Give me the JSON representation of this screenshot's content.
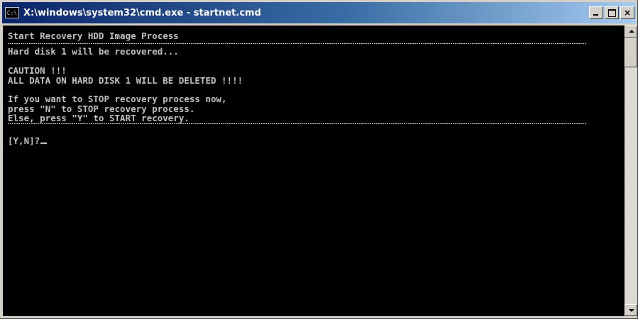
{
  "window": {
    "title": "X:\\windows\\system32\\cmd.exe - startnet.cmd",
    "icon_label": "C:\\",
    "buttons": {
      "minimize": "minimize",
      "maximize": "maximize",
      "close": "×"
    }
  },
  "console": {
    "header": "Start Recovery HDD Image Process",
    "line_recovered": "Hard disk 1 will be recovered...",
    "caution": "CAUTION !!!",
    "warning": "ALL DATA ON HARD DISK 1 WILL BE DELETED !!!!",
    "instruction_1": "If you want to STOP recovery process now,",
    "instruction_2": "press \"N\" to STOP recovery process.",
    "instruction_3": "Else, press \"Y\" to START recovery.",
    "prompt": "[Y,N]?"
  },
  "colors": {
    "console_bg": "#000000",
    "console_fg": "#c0c0c0",
    "titlebar_start": "#0a246a",
    "titlebar_end": "#a6caf0"
  }
}
